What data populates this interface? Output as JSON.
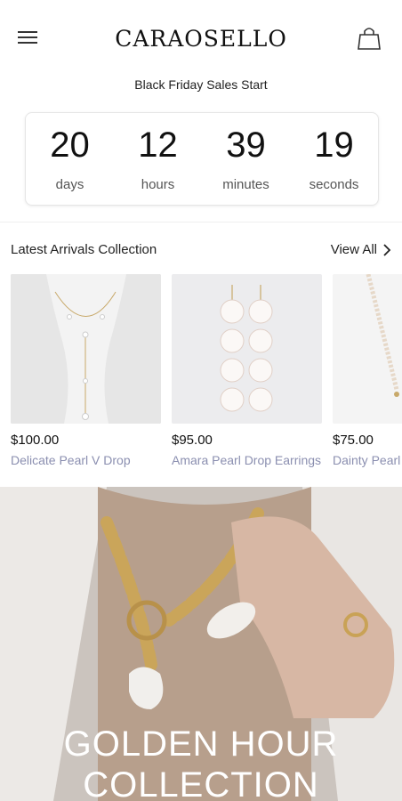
{
  "brand": {
    "logo_text": "CARAOSELLO"
  },
  "promo": {
    "text": "Black Friday Sales Start"
  },
  "countdown": [
    {
      "value": "20",
      "unit": "days"
    },
    {
      "value": "12",
      "unit": "hours"
    },
    {
      "value": "39",
      "unit": "minutes"
    },
    {
      "value": "19",
      "unit": "seconds"
    }
  ],
  "latest": {
    "title": "Latest Arrivals Collection",
    "view_all": "View All",
    "products": [
      {
        "price": "$100.00",
        "name": "Delicate Pearl V Drop"
      },
      {
        "price": "$95.00",
        "name": "Amara Pearl Drop Earrings"
      },
      {
        "price": "$75.00",
        "name": "Dainty Pearl S"
      }
    ]
  },
  "hero": {
    "title_line1": "GOLDEN HOUR",
    "title_line2": "COLLECTION"
  },
  "icons": {
    "menu": "hamburger-menu-icon",
    "bag": "shopping-bag-icon",
    "view_all": "chevron-right-icon"
  }
}
